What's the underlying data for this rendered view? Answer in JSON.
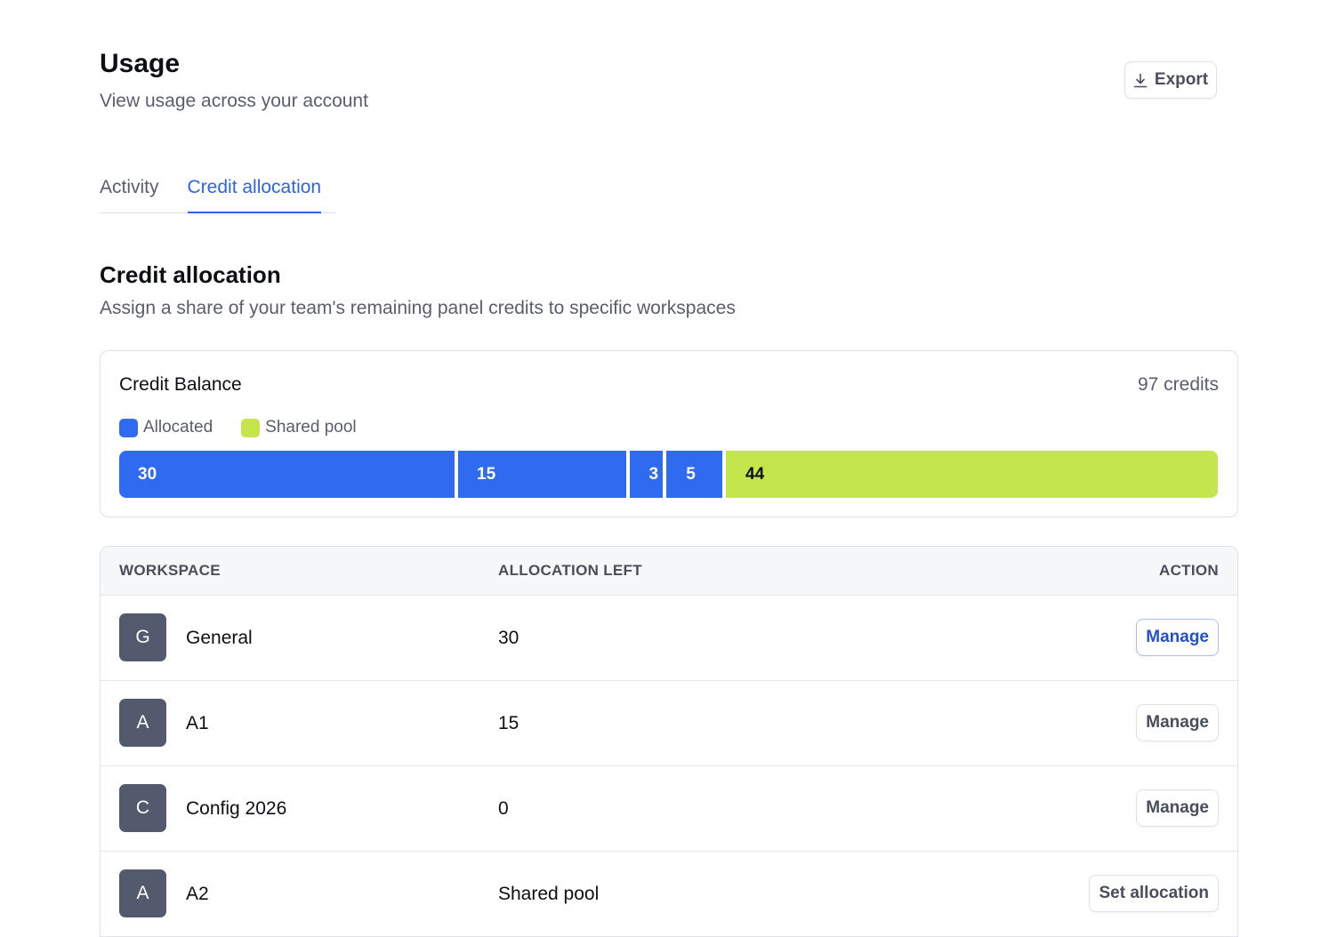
{
  "header": {
    "title": "Usage",
    "subtitle": "View usage across your account",
    "export_label": "Export"
  },
  "tabs": [
    {
      "label": "Activity",
      "active": false
    },
    {
      "label": "Credit allocation",
      "active": true
    }
  ],
  "section": {
    "title": "Credit allocation",
    "subtitle": "Assign a share of your team's remaining panel credits to specific workspaces"
  },
  "balance": {
    "title": "Credit Balance",
    "total_label": "97 credits",
    "legend": [
      {
        "label": "Allocated",
        "color": "#2f6bf0"
      },
      {
        "label": "Shared pool",
        "color": "#c4e54b"
      }
    ],
    "segments": [
      {
        "label": "30",
        "value": 30,
        "type": "allocated"
      },
      {
        "label": "15",
        "value": 15,
        "type": "allocated"
      },
      {
        "label": "3",
        "value": 3,
        "type": "allocated"
      },
      {
        "label": "5",
        "value": 5,
        "type": "allocated"
      },
      {
        "label": "44",
        "value": 44,
        "type": "pool"
      }
    ]
  },
  "table": {
    "headers": {
      "workspace": "WORKSPACE",
      "allocation": "ALLOCATION LEFT",
      "action": "ACTION"
    },
    "rows": [
      {
        "initial": "G",
        "name": "General",
        "allocation": "30",
        "action": "Manage"
      },
      {
        "initial": "A",
        "name": "A1",
        "allocation": "15",
        "action": "Manage"
      },
      {
        "initial": "C",
        "name": "Config 2026",
        "allocation": "0",
        "action": "Manage"
      },
      {
        "initial": "A",
        "name": "A2",
        "allocation": "Shared pool",
        "action": "Set allocation"
      }
    ]
  },
  "colors": {
    "accent": "#2d63e6",
    "allocated": "#2f6bf0",
    "pool": "#c4e54b",
    "avatar": "#545a6e"
  }
}
